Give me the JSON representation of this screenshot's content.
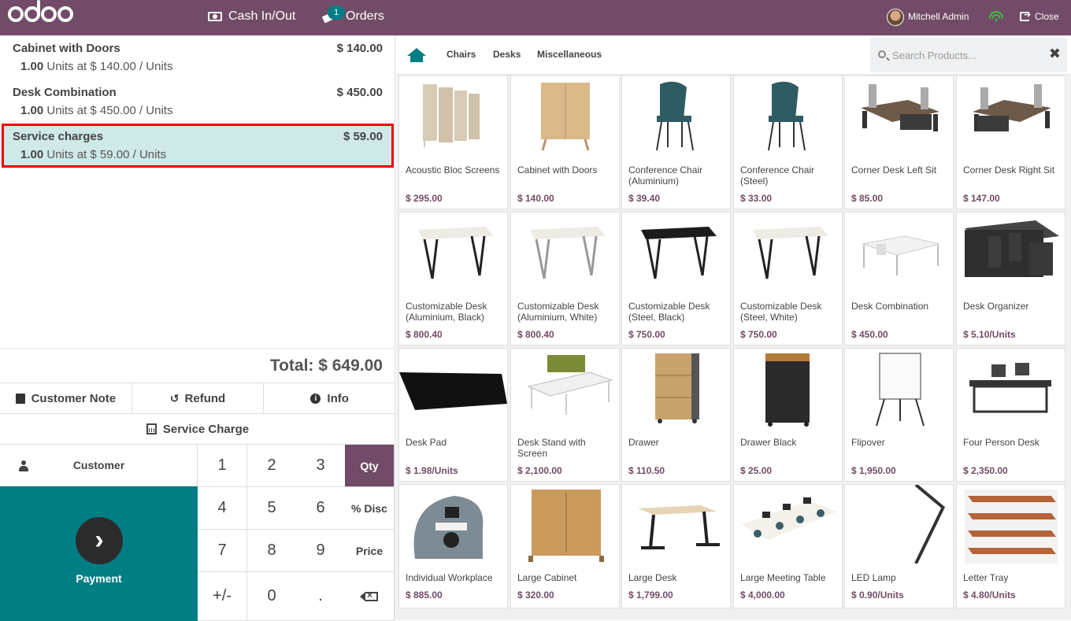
{
  "topbar": {
    "cash_label": "Cash In/Out",
    "orders_label": "Orders",
    "orders_count": "1",
    "user_name": "Mitchell Admin",
    "close_label": "Close"
  },
  "order": {
    "lines": [
      {
        "name": "Cabinet with Doors",
        "price": "$ 140.00",
        "qty": "1.00",
        "unit_text": "Units at $ 140.00 / Units"
      },
      {
        "name": "Desk Combination",
        "price": "$ 450.00",
        "qty": "1.00",
        "unit_text": "Units at $ 450.00 / Units"
      },
      {
        "name": "Service charges",
        "price": "$ 59.00",
        "qty": "1.00",
        "unit_text": "Units at $ 59.00 / Units"
      }
    ],
    "total": "Total: $ 649.00"
  },
  "controls": {
    "customer_note": "Customer Note",
    "refund": "Refund",
    "info": "Info",
    "service_charge": "Service Charge"
  },
  "pad": {
    "customer": "Customer",
    "payment": "Payment",
    "k1": "1",
    "k2": "2",
    "k3": "3",
    "k4": "4",
    "k5": "5",
    "k6": "6",
    "k7": "7",
    "k8": "8",
    "k9": "9",
    "kpm": "+/-",
    "k0": "0",
    "kdot": ".",
    "qty": "Qty",
    "disc": "% Disc",
    "price": "Price",
    "active_mode": "Qty"
  },
  "categories": {
    "items": [
      "Chairs",
      "Desks",
      "Miscellaneous"
    ],
    "search_placeholder": "Search Products..."
  },
  "products": [
    {
      "name": "Acoustic Bloc Screens",
      "price": "$ 295.00"
    },
    {
      "name": "Cabinet with Doors",
      "price": "$ 140.00"
    },
    {
      "name": "Conference Chair (Aluminium)",
      "price": "$ 39.40"
    },
    {
      "name": "Conference Chair (Steel)",
      "price": "$ 33.00"
    },
    {
      "name": "Corner Desk Left Sit",
      "price": "$ 85.00"
    },
    {
      "name": "Corner Desk Right Sit",
      "price": "$ 147.00"
    },
    {
      "name": "Customizable Desk (Aluminium, Black)",
      "price": "$ 800.40"
    },
    {
      "name": "Customizable Desk (Aluminium, White)",
      "price": "$ 800.40"
    },
    {
      "name": "Customizable Desk (Steel, Black)",
      "price": "$ 750.00"
    },
    {
      "name": "Customizable Desk (Steel, White)",
      "price": "$ 750.00"
    },
    {
      "name": "Desk Combination",
      "price": "$ 450.00"
    },
    {
      "name": "Desk Organizer",
      "price": "$ 5.10/Units"
    },
    {
      "name": "Desk Pad",
      "price": "$ 1.98/Units"
    },
    {
      "name": "Desk Stand with Screen",
      "price": "$ 2,100.00"
    },
    {
      "name": "Drawer",
      "price": "$ 110.50"
    },
    {
      "name": "Drawer Black",
      "price": "$ 25.00"
    },
    {
      "name": "Flipover",
      "price": "$ 1,950.00"
    },
    {
      "name": "Four Person Desk",
      "price": "$ 2,350.00"
    },
    {
      "name": "Individual Workplace",
      "price": "$ 885.00"
    },
    {
      "name": "Large Cabinet",
      "price": "$ 320.00"
    },
    {
      "name": "Large Desk",
      "price": "$ 1,799.00"
    },
    {
      "name": "Large Meeting Table",
      "price": "$ 4,000.00"
    },
    {
      "name": "LED Lamp",
      "price": "$ 0.90/Units"
    },
    {
      "name": "Letter Tray",
      "price": "$ 4.80/Units"
    }
  ],
  "colors": {
    "brand": "#714b67",
    "teal": "#017e84",
    "selected_line": "#cfe8e8",
    "highlight_border": "#ee0000"
  }
}
